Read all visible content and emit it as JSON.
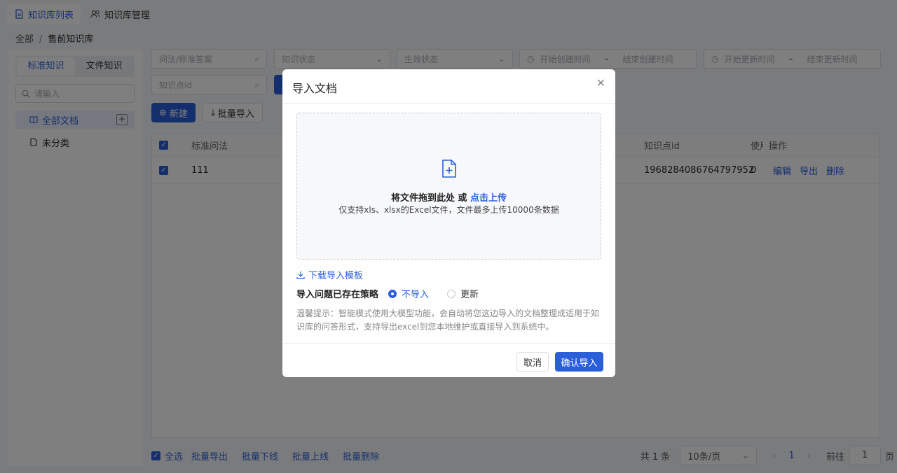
{
  "top_tabs": [
    {
      "label": "知识库列表"
    },
    {
      "label": "知识库管理"
    }
  ],
  "breadcrumb": {
    "root": "全部",
    "sep": "/",
    "current": "售前知识库"
  },
  "left_panel": {
    "segments": [
      "标准知识",
      "文件知识"
    ],
    "search_placeholder": "请输入",
    "tree": [
      {
        "label": "全部文档"
      },
      {
        "label": "未分类"
      }
    ],
    "add_symbol": "+"
  },
  "filters": {
    "question": "问法/标准答案",
    "status": "知识状态",
    "effective": "生效状态",
    "create_start": "开始创建时间",
    "create_end": "结束创建时间",
    "update_start": "开始更新时间",
    "update_end": "结束更新时间",
    "range_sep": "–",
    "knowledge_id": "知识点id"
  },
  "toolbar": {
    "new_label": "新建",
    "batch_import_label": "批量导入"
  },
  "table": {
    "headers": {
      "question": "标准问法",
      "kid": "知识点id",
      "use": "使用",
      "op": "操作"
    },
    "rows": [
      {
        "question": "111",
        "kid": "1968284086764797952",
        "use": "0",
        "actions": [
          "编辑",
          "导出",
          "删除"
        ]
      }
    ]
  },
  "footer": {
    "select_all": "全选",
    "actions": [
      "批量导出",
      "批量下线",
      "批量上线",
      "批量删除"
    ],
    "total": "共 1 条",
    "page_size": "10条/页",
    "current_page": "1",
    "goto_label": "前往",
    "goto_value": "1",
    "page_unit": "页"
  },
  "modal": {
    "title": "导入文档",
    "drop_text": "将文件拖到此处",
    "drop_or": "或",
    "drop_link": "点击上传",
    "drop_sub": "仅支持xls、xlsx的Excel文件，文件最多上传10000条数据",
    "download_template": "下载导入模板",
    "strategy_label": "导入问题已存在策略",
    "strategy_options": [
      {
        "label": "不导入",
        "selected": true
      },
      {
        "label": "更新",
        "selected": false
      }
    ],
    "hint": "温馨提示：智能模式使用大模型功能，会自动将您这边导入的文档整理成适用于知识库的问答形式，支持导出excel到您本地维护或直接导入到系统中。",
    "cancel_label": "取消",
    "confirm_label": "确认导入"
  },
  "colors": {
    "accent": "#2b5fd9",
    "overlay": "rgba(0,0,0,0.5)"
  }
}
